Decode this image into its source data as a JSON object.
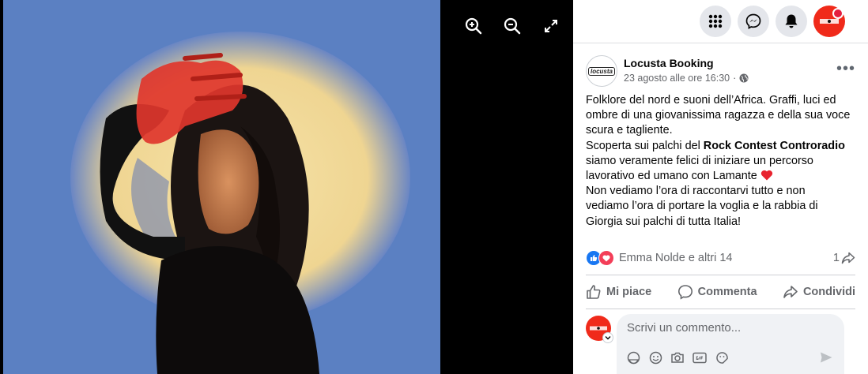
{
  "viewer": {
    "tools": [
      "zoom-in-icon",
      "zoom-out-icon",
      "fullscreen-icon"
    ]
  },
  "topbar": {
    "icons": [
      "menu-grid-icon",
      "messenger-icon",
      "notifications-bell-icon",
      "account-avatar"
    ],
    "avatar_color": "#f02a1a"
  },
  "post": {
    "avatar_text": "locusta",
    "page_name": "Locusta Booking",
    "timestamp": "23 agosto alle ore 16:30",
    "separator": "·",
    "text": {
      "line1": "Folklore del nord e suoni dell’Africa. Graffi, luci ed ombre di una giovanissima ragazza e della sua voce scura e tagliente.",
      "line2_before": "Scoperta sui palchi del ",
      "line2_bold": "Rock Contest Controradio",
      "line2_after": " siamo veramente felici di iniziare un percorso lavorativo ed umano con Lamante",
      "line3": "Non vediamo l’ora di raccontarvi tutto e non vediamo l’ora di portare la voglia e la rabbia di Giorgia sui palchi di tutta Italia!"
    },
    "reactions": {
      "names": "Emma Nolde e altri 14",
      "shares": "1"
    },
    "actions": {
      "like": "Mi piace",
      "comment": "Commenta",
      "share": "Condividi"
    }
  },
  "comment": {
    "placeholder": "Scrivi un commento..."
  },
  "colors": {
    "like_blue": "#1877f2",
    "love_red": "#f33e58",
    "secondary_text": "#65676b"
  }
}
